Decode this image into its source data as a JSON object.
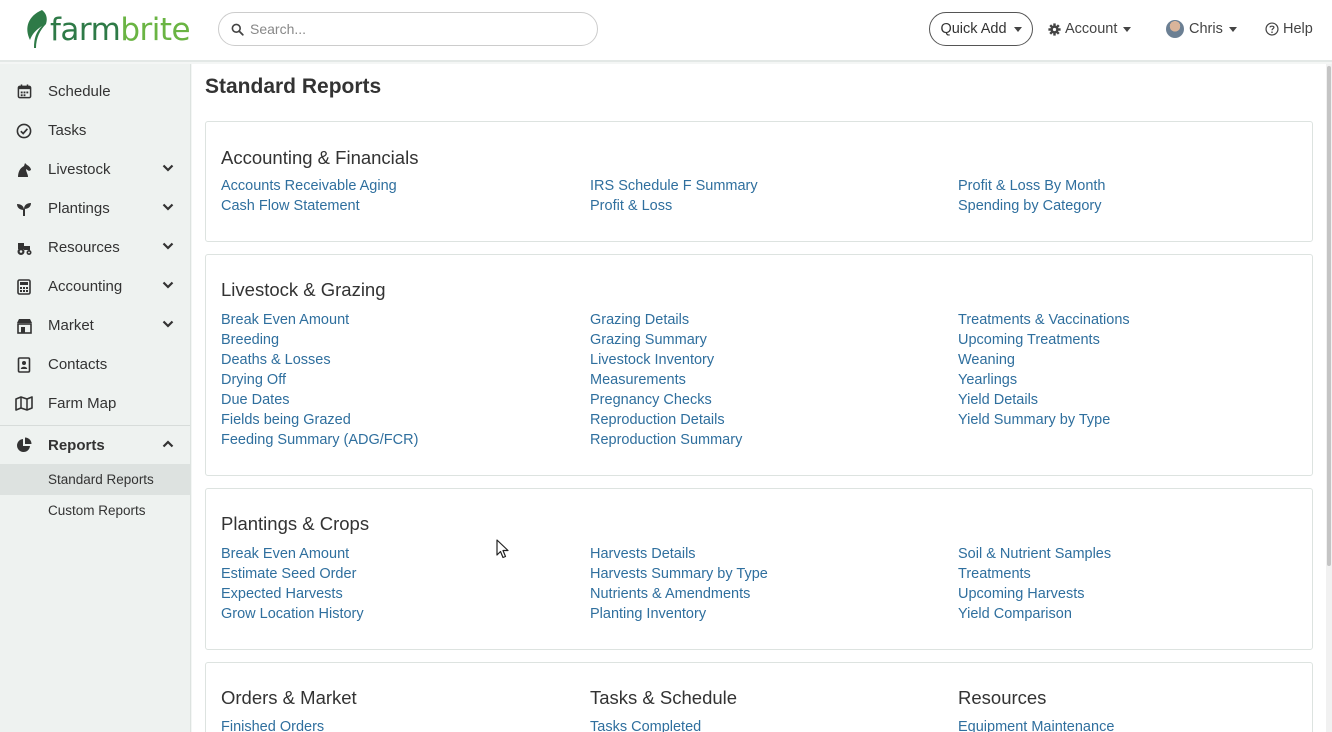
{
  "brand": {
    "part1": "farm",
    "part2": "brite",
    "brand_green": "#2e7a47",
    "brand_light": "#6ab443"
  },
  "header": {
    "search_placeholder": "Search...",
    "quick_add": "Quick Add",
    "account": "Account",
    "user": "Chris",
    "help": "Help"
  },
  "sidebar": {
    "items": [
      {
        "label": "Schedule",
        "icon": "calendar-icon"
      },
      {
        "label": "Tasks",
        "icon": "check-circle-icon"
      },
      {
        "label": "Livestock",
        "icon": "horse-icon",
        "expandable": true
      },
      {
        "label": "Plantings",
        "icon": "seedling-icon",
        "expandable": true
      },
      {
        "label": "Resources",
        "icon": "tractor-icon",
        "expandable": true
      },
      {
        "label": "Accounting",
        "icon": "calculator-icon",
        "expandable": true
      },
      {
        "label": "Market",
        "icon": "store-icon",
        "expandable": true
      },
      {
        "label": "Contacts",
        "icon": "address-book-icon"
      },
      {
        "label": "Farm Map",
        "icon": "map-icon"
      }
    ],
    "reports": {
      "label": "Reports",
      "icon": "pie-chart-icon",
      "expanded": true
    },
    "sub_items": [
      "Standard Reports",
      "Custom Reports"
    ],
    "active_sub": "Standard Reports"
  },
  "main": {
    "title": "Standard Reports",
    "sections": [
      {
        "title": "Accounting & Financials",
        "columns": [
          [
            "Accounts Receivable Aging",
            "Cash Flow Statement"
          ],
          [
            "IRS Schedule F Summary",
            "Profit & Loss"
          ],
          [
            "Profit & Loss By Month",
            "Spending by Category"
          ]
        ]
      },
      {
        "title": "Livestock & Grazing",
        "columns": [
          [
            "Break Even Amount",
            "Breeding",
            "Deaths & Losses",
            "Drying Off",
            "Due Dates",
            "Fields being Grazed",
            "Feeding Summary (ADG/FCR)"
          ],
          [
            "Grazing Details",
            "Grazing Summary",
            "Livestock Inventory",
            "Measurements",
            "Pregnancy Checks",
            "Reproduction Details",
            "Reproduction Summary"
          ],
          [
            "Treatments & Vaccinations",
            "Upcoming Treatments",
            "Weaning",
            "Yearlings",
            "Yield Details",
            "Yield Summary by Type"
          ]
        ]
      },
      {
        "title": "Plantings & Crops",
        "columns": [
          [
            "Break Even Amount",
            "Estimate Seed Order",
            "Expected Harvests",
            "Grow Location History"
          ],
          [
            "Harvests Details",
            "Harvests Summary by Type",
            "Nutrients & Amendments",
            "Planting Inventory"
          ],
          [
            "Soil & Nutrient Samples",
            "Treatments",
            "Upcoming Harvests",
            "Yield Comparison"
          ]
        ]
      }
    ],
    "bottom": [
      {
        "title": "Orders & Market",
        "links": [
          "Finished Orders"
        ]
      },
      {
        "title": "Tasks & Schedule",
        "links": [
          "Tasks Completed"
        ]
      },
      {
        "title": "Resources",
        "links": [
          "Equipment Maintenance"
        ]
      }
    ]
  }
}
